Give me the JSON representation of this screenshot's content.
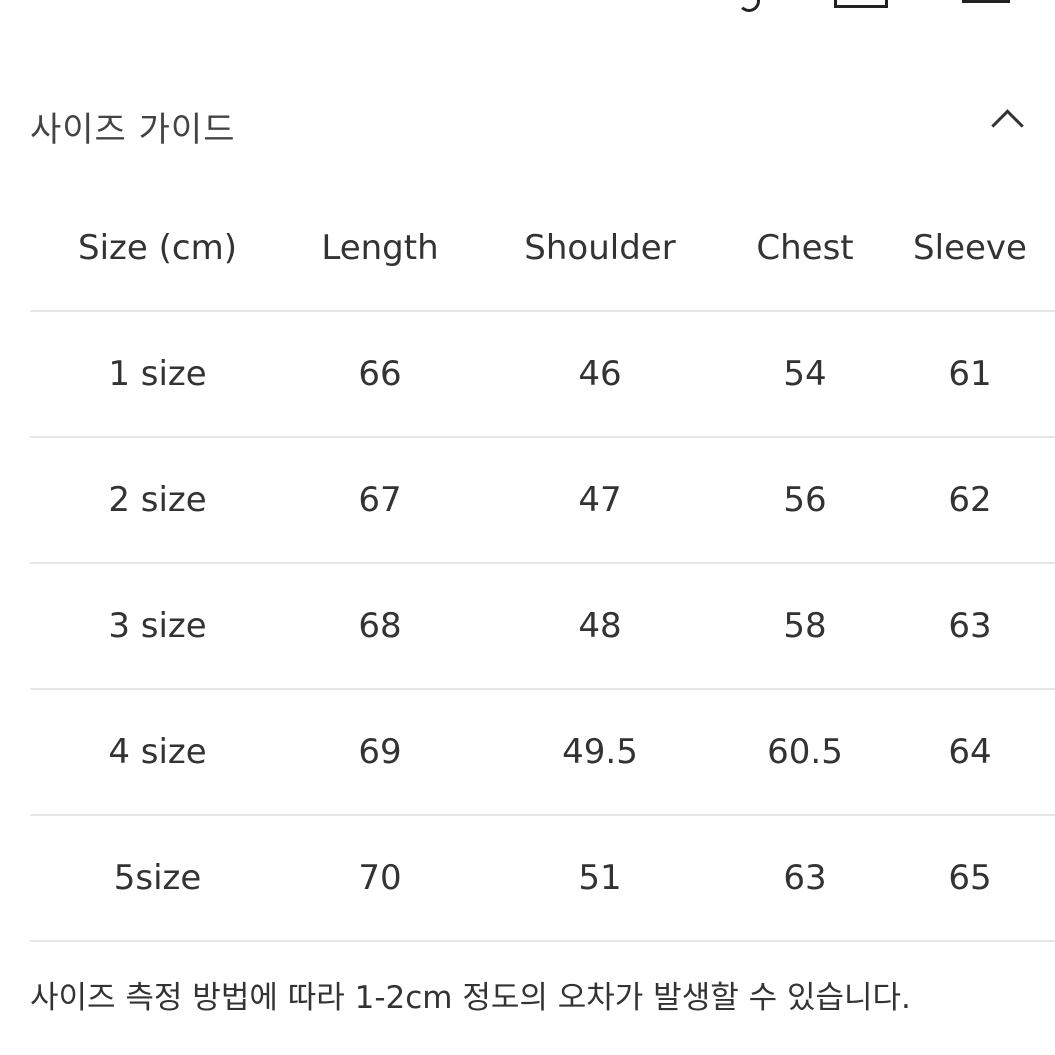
{
  "header": {
    "icons": [
      "logo",
      "search-icon",
      "shopping-bag-icon",
      "menu-icon"
    ]
  },
  "section": {
    "title": "사이즈 가이드",
    "toggle_icon": "chevron-up-icon"
  },
  "table": {
    "columns": [
      "Size (cm)",
      "Length",
      "Shoulder",
      "Chest",
      "Sleeve"
    ],
    "rows": [
      [
        "1 size",
        "66",
        "46",
        "54",
        "61"
      ],
      [
        "2 size",
        "67",
        "47",
        "56",
        "62"
      ],
      [
        "3 size",
        "68",
        "48",
        "58",
        "63"
      ],
      [
        "4 size",
        "69",
        "49.5",
        "60.5",
        "64"
      ],
      [
        "5size",
        "70",
        "51",
        "63",
        "65"
      ]
    ]
  },
  "note": "사이즈 측정 방법에 따라 1-2cm 정도의 오차가 발생할 수 있습니다."
}
